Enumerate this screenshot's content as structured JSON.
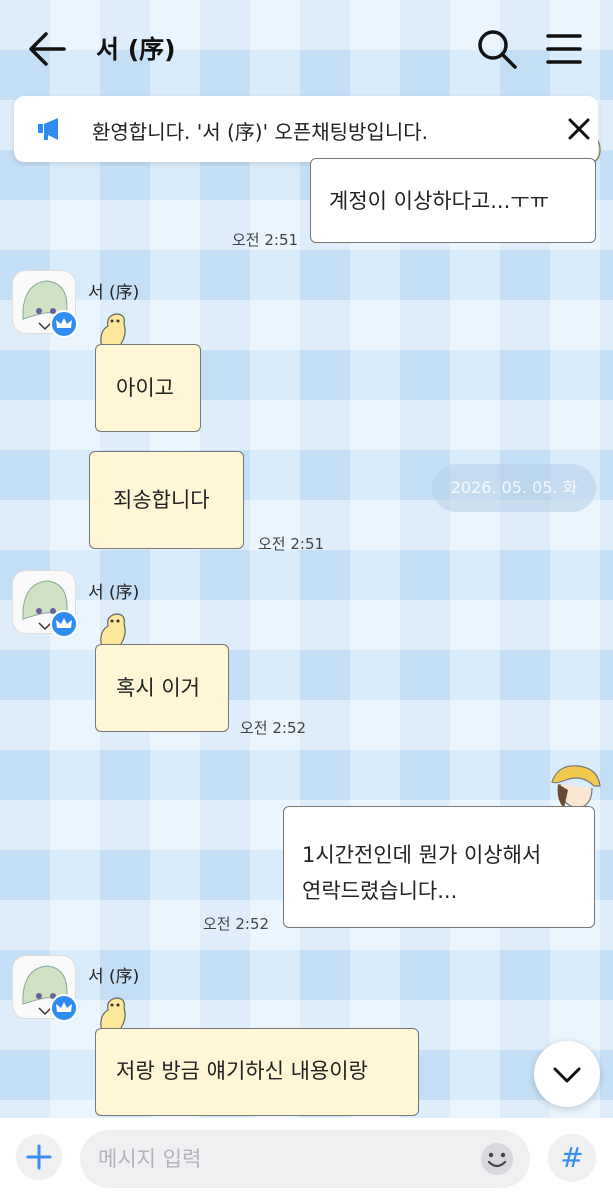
{
  "header": {
    "title": "서 (序)",
    "icons": [
      "back-arrow-icon",
      "search-icon",
      "menu-icon"
    ]
  },
  "notice": {
    "text": "환영합니다. '서 (序)' 오픈채팅방입니다.",
    "icon": "megaphone-icon"
  },
  "date_divider": "2026. 05. 05. 화",
  "messages": [
    {
      "sender": "",
      "direction": "out",
      "lines": [
        "계정이 이상하다고...ㅜㅠ"
      ],
      "time": "오전 2:51"
    },
    {
      "sender": "서 (序)",
      "direction": "in",
      "lines": [
        "아이고"
      ],
      "time": ""
    },
    {
      "sender": "",
      "direction": "in",
      "lines": [
        "죄송합니다"
      ],
      "time": "오전 2:51"
    },
    {
      "sender": "서 (序)",
      "direction": "in",
      "lines": [
        "혹시 이거"
      ],
      "time": "오전 2:52"
    },
    {
      "sender": "",
      "direction": "out",
      "lines": [
        "1시간전인데 뭔가 이상해서",
        "연락드렸습니다..."
      ],
      "time": "오전 2:52"
    },
    {
      "sender": "서 (序)",
      "direction": "in",
      "lines": [
        "저랑 방금 얘기하신 내용이랑"
      ],
      "time": ""
    }
  ],
  "composer": {
    "placeholder": "메시지 입력",
    "hash_label": "#"
  },
  "colors": {
    "accent": "#2f8cf0",
    "incoming_bubble": "#fff6d5",
    "outgoing_bubble": "#ffffff"
  }
}
